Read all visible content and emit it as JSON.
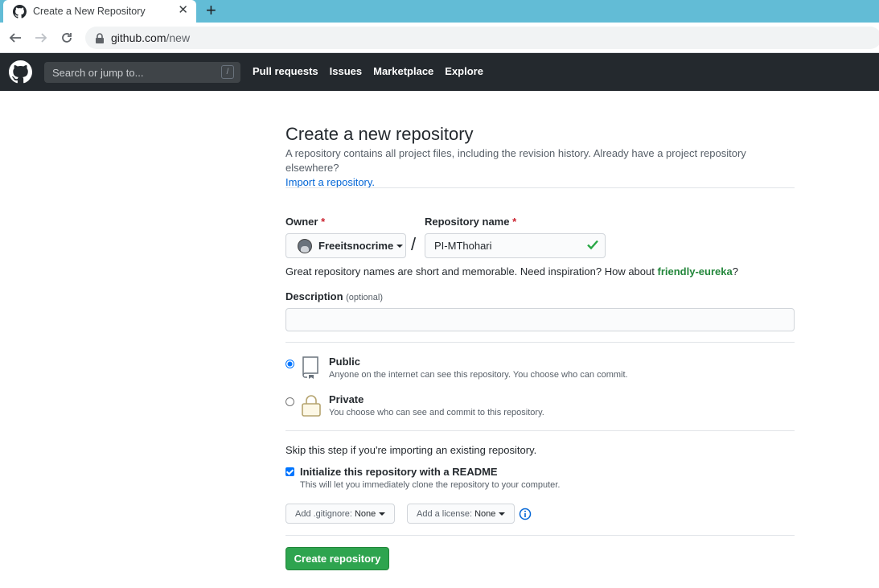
{
  "browser": {
    "tab_title": "Create a New Repository",
    "tab_close": "✕",
    "new_tab": "+",
    "url_host": "github.com",
    "url_path": "/new"
  },
  "gh_header": {
    "search_placeholder": "Search or jump to...",
    "search_key": "/",
    "nav": [
      "Pull requests",
      "Issues",
      "Marketplace",
      "Explore"
    ]
  },
  "page": {
    "title": "Create a new repository",
    "subhead": "A repository contains all project files, including the revision history. Already have a project repository elsewhere?",
    "import_link": "Import a repository.",
    "owner_label": "Owner",
    "repo_label": "Repository name",
    "required_mark": "*",
    "owner_value": "Freeitsnocrime",
    "separator": "/",
    "repo_value": "PI-MThohari",
    "hint_text": "Great repository names are short and memorable. Need inspiration? How about",
    "hint_suggestion": "friendly-eureka",
    "hint_end": "?",
    "description_label": "Description",
    "description_optional": "(optional)",
    "visibility": {
      "public_title": "Public",
      "public_note": "Anyone on the internet can see this repository. You choose who can commit.",
      "private_title": "Private",
      "private_note": "You choose who can see and commit to this repository.",
      "selected": "public"
    },
    "skip_text": "Skip this step if you're importing an existing repository.",
    "readme_label": "Initialize this repository with a README",
    "readme_note": "This will let you immediately clone the repository to your computer.",
    "readme_checked": true,
    "gitignore_prefix": "Add .gitignore:",
    "gitignore_value": "None",
    "license_prefix": "Add a license:",
    "license_value": "None",
    "create_button": "Create repository"
  },
  "colors": {
    "tab_strip": "#62bcd6",
    "header_bg": "#24292e",
    "link": "#0366d6",
    "success": "#2ea44f",
    "required": "#cb2431",
    "suggestion": "#22863a"
  },
  "icons": {
    "favicon": "github-octocat-icon",
    "back": "arrow-left-icon",
    "forward": "arrow-right-icon",
    "reload": "reload-icon",
    "secure": "lock-icon",
    "logo": "github-logo-icon",
    "valid": "check-icon",
    "public": "repo-icon",
    "private": "lock-icon",
    "info": "info-icon"
  }
}
